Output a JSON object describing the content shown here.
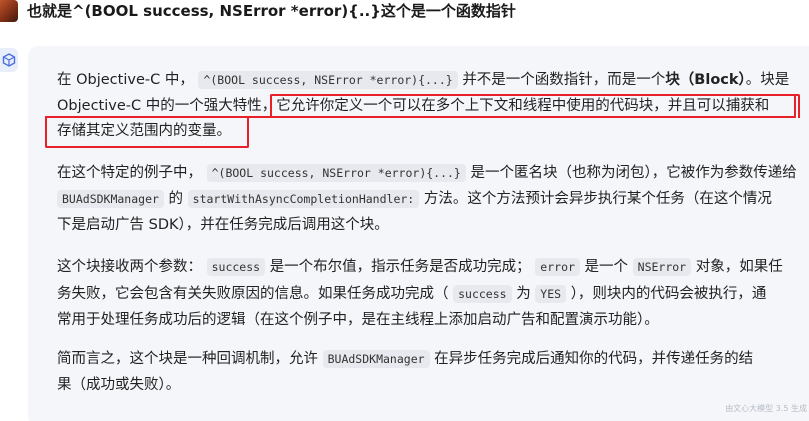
{
  "header": {
    "question": "也就是^(BOOL success, NSError *error){..}这个是一个函数指针"
  },
  "answer": {
    "p1": {
      "a": "在 Objective-C 中，",
      "code1": "^(BOOL success, NSError *error){...}",
      "b": "并不是一个函数指针，而是一个",
      "bold": "块（Block）",
      "c": "。块是",
      "line2_pre": "Objective-C 中的一个强大特性，",
      "line2_hl": "它允许你定义一个可以在多个上下文和线程中使用的代码块，并且可以捕获和",
      "line3_hl": "存储其定义范围内的变量。"
    },
    "p2": {
      "a": "在这个特定的例子中，",
      "code1": "^(BOOL success, NSError *error){...}",
      "b": "是一个匿名块（也称为闭包），它被作为参数传递给",
      "code2": "BUAdSDKManager",
      "c": "的",
      "code3": "startWithAsyncCompletionHandler:",
      "d": "方法。这个方法预计会异步执行某个任务（在这个情况",
      "e": "下是启动广告 SDK），并在任务完成后调用这个块。"
    },
    "p3": {
      "a": "这个块接收两个参数：",
      "code1": "success",
      "b": "是一个布尔值，指示任务是否成功完成；",
      "code2": "error",
      "c": "是一个",
      "code3": "NSError",
      "d": "对象，如果任",
      "e": "务失败，它会包含有关失败原因的信息。如果任务成功完成（",
      "code4": "success",
      "f": "为",
      "code5": "YES",
      "g": "），则块内的代码会被执行，通",
      "h": "常用于处理任务成功后的逻辑（在这个例子中，是在主线程上添加启动广告和配置演示功能）。"
    },
    "p4": {
      "a": "简而言之，这个块是一种回调机制，允许",
      "code1": "BUAdSDKManager",
      "b": "在异步任务完成后通知你的代码，并传递任务的结",
      "c": "果（成功或失败）。"
    }
  },
  "footer": {
    "note": "由文心大模型 3.5 生成"
  },
  "colors": {
    "highlight_border": "#e8202a",
    "card_background": "#f4f6fa"
  },
  "icons": {
    "user": "user-avatar",
    "bot": "assistant-cube-icon"
  }
}
